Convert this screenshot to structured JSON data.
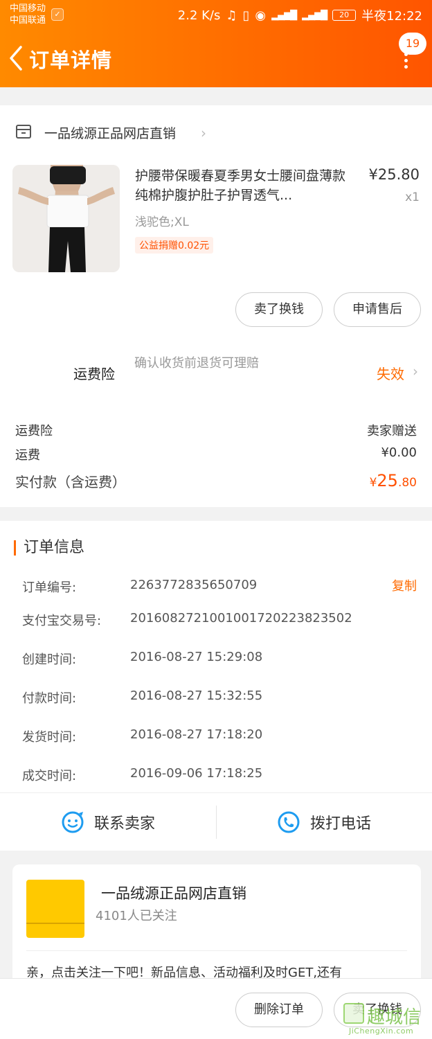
{
  "status_bar": {
    "carrier_1": "中国移动",
    "carrier_2": "中国联通",
    "speed": "2.2 K/s",
    "battery": "20",
    "time": "半夜12:22"
  },
  "nav": {
    "title": "订单详情",
    "badge": "19"
  },
  "shop": {
    "name": "一品绒源正品网店直销"
  },
  "product": {
    "title": "护腰带保暖春夏季男女士腰间盘薄款纯棉护腹护肚子护胃透气...",
    "price": "¥25.80",
    "qty": "x1",
    "sku": "浅驼色;XL",
    "tag": "公益捐赠0.02元"
  },
  "actions": {
    "sell_label": "卖了换钱",
    "aftersale_label": "申请售后"
  },
  "insurance": {
    "label": "运费险",
    "desc": "确认收货前退货可理赔",
    "status": "失效"
  },
  "fees": {
    "ins_label": "运费险",
    "ins_value": "卖家赠送",
    "ship_label": "运费",
    "ship_value": "¥0.00",
    "total_label": "实付款（含运费）",
    "total_currency": "¥",
    "total_int": "25",
    "total_dec": ".80"
  },
  "order_info": {
    "title": "订单信息",
    "copy_label": "复制",
    "rows": [
      {
        "label": "订单编号:",
        "value": "2263772835650709"
      },
      {
        "label": "支付宝交易号:",
        "value": "2016082721001001720223823502"
      },
      {
        "label": "创建时间:",
        "value": "2016-08-27 15:29:08"
      },
      {
        "label": "付款时间:",
        "value": "2016-08-27 15:32:55"
      },
      {
        "label": "发货时间:",
        "value": "2016-08-27 17:18:20"
      },
      {
        "label": "成交时间:",
        "value": "2016-09-06 17:18:25"
      }
    ],
    "contact_seller": "联系卖家",
    "call_phone": "拨打电话"
  },
  "follow": {
    "name": "一品绒源正品网店直销",
    "count": "4101人已关注",
    "text": "亲，点击关注一下吧！新品信息、活动福利及时GET,还有"
  },
  "bottom": {
    "delete_label": "删除订单",
    "sell_label": "卖了换钱"
  },
  "watermark": {
    "text": "趣城信",
    "sub": "JiChengXin.com"
  },
  "colors": {
    "brand": "#ff6a00",
    "price": "#ff5000"
  }
}
